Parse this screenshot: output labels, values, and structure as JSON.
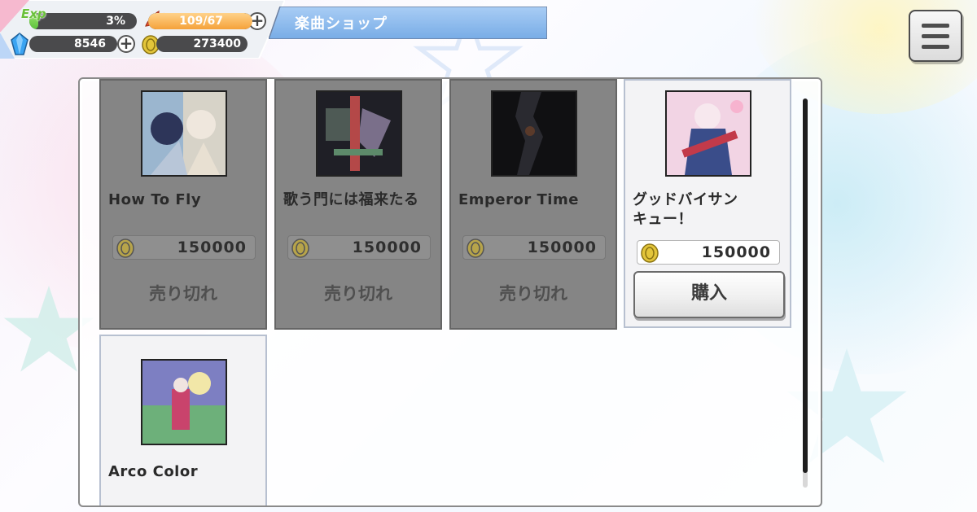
{
  "hud": {
    "exp_label": "Exp",
    "exp_value": "3%",
    "exp_progress": 0.03,
    "stamina_value": "109/67",
    "gems_value": "8546",
    "coins_value": "273400"
  },
  "header": {
    "title": "楽曲ショップ"
  },
  "menu": {
    "icon": "hamburger-menu-icon"
  },
  "shop": {
    "items": [
      {
        "title": "How To Fly",
        "price": "150000",
        "status": "売り切れ"
      },
      {
        "title": "歌う門には福来たる",
        "price": "150000",
        "status": "売り切れ"
      },
      {
        "title": "Emperor Time",
        "price": "150000",
        "status": "売り切れ"
      },
      {
        "title_line1": "グッドバイサン",
        "title_line2": "キュー！",
        "price": "150000",
        "buy_label": "購入"
      },
      {
        "title": "Arco Color"
      }
    ]
  },
  "colors": {
    "title_banner": "#8ab8ee",
    "sold_card": "#858585",
    "stamina_fill": "#f5a23a",
    "exp_fill": "#5cc23d"
  }
}
